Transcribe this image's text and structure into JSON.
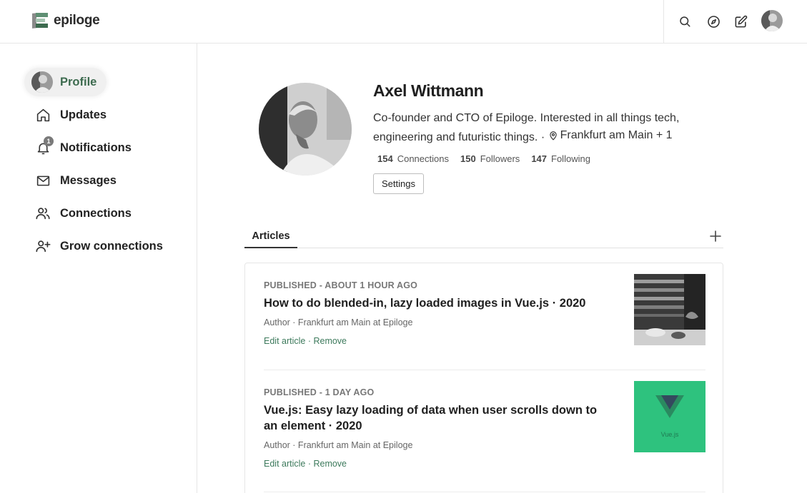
{
  "header": {
    "logo_text": "epiloge",
    "icons": [
      "search-icon",
      "compass-icon",
      "compose-icon",
      "user-avatar"
    ]
  },
  "sidebar": {
    "items": [
      {
        "label": "Profile",
        "icon": "avatar",
        "active": true
      },
      {
        "label": "Updates",
        "icon": "home-icon"
      },
      {
        "label": "Notifications",
        "icon": "bell-icon",
        "badge": "1"
      },
      {
        "label": "Messages",
        "icon": "mail-icon"
      },
      {
        "label": "Connections",
        "icon": "users-icon"
      },
      {
        "label": "Grow connections",
        "icon": "user-plus-icon"
      }
    ]
  },
  "profile": {
    "name": "Axel Wittmann",
    "bio": "Co-founder and CTO of Epiloge. Interested in all things tech, engineering and futuristic things. · ",
    "location": "Frankfurt am Main + 1",
    "stats": {
      "connections_count": "154",
      "connections_label": "Connections",
      "followers_count": "150",
      "followers_label": "Followers",
      "following_count": "147",
      "following_label": "Following"
    },
    "settings_label": "Settings"
  },
  "tabs": {
    "articles_label": "Articles"
  },
  "articles": [
    {
      "status": "PUBLISHED - ABOUT 1 HOUR AGO",
      "title": "How to do blended-in, lazy loaded images in Vue.js · 2020",
      "meta": "Author · Frankfurt am Main at Epiloge",
      "edit_label": "Edit article",
      "separator": " · ",
      "remove_label": "Remove"
    },
    {
      "status": "PUBLISHED - 1 DAY AGO",
      "title": "Vue.js: Easy lazy loading of data when user scrolls down to an element · 2020",
      "meta": "Author · Frankfurt am Main at Epiloge",
      "edit_label": "Edit article",
      "separator": " · ",
      "remove_label": "Remove",
      "thumb_text": "Vue.js"
    }
  ],
  "colors": {
    "accent": "#3d7a5c",
    "active_label": "#3d6b4f",
    "vue_green": "#2ec27e",
    "border": "#e6e6e6"
  }
}
